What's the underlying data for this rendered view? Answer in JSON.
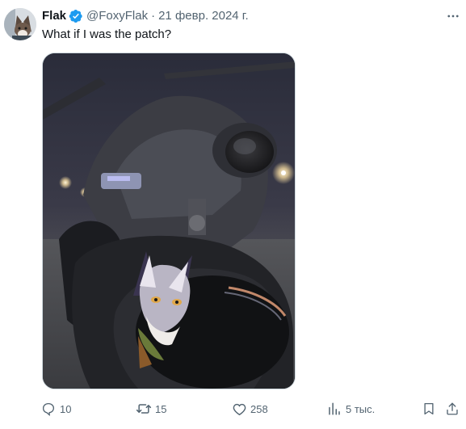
{
  "tweet": {
    "author_name": "Flak",
    "handle": "@FoxyFlak",
    "separator": "·",
    "date": "21 февр. 2024 г.",
    "text": "What if I was the patch?",
    "verified": true,
    "media": {
      "type": "photo"
    }
  },
  "actions": {
    "replies": "10",
    "retweets": "15",
    "likes": "258",
    "views": "5 тыс."
  },
  "icons": {
    "avatar": "fox-avatar",
    "verified": "verified-badge-icon",
    "more": "more-dots-icon",
    "reply": "reply-icon",
    "retweet": "retweet-icon",
    "like": "heart-icon",
    "views": "views-icon",
    "bookmark": "bookmark-icon",
    "share": "share-icon"
  },
  "colors": {
    "text_primary": "#0f1419",
    "text_secondary": "#536471",
    "verified_blue": "#1d9bf0"
  }
}
